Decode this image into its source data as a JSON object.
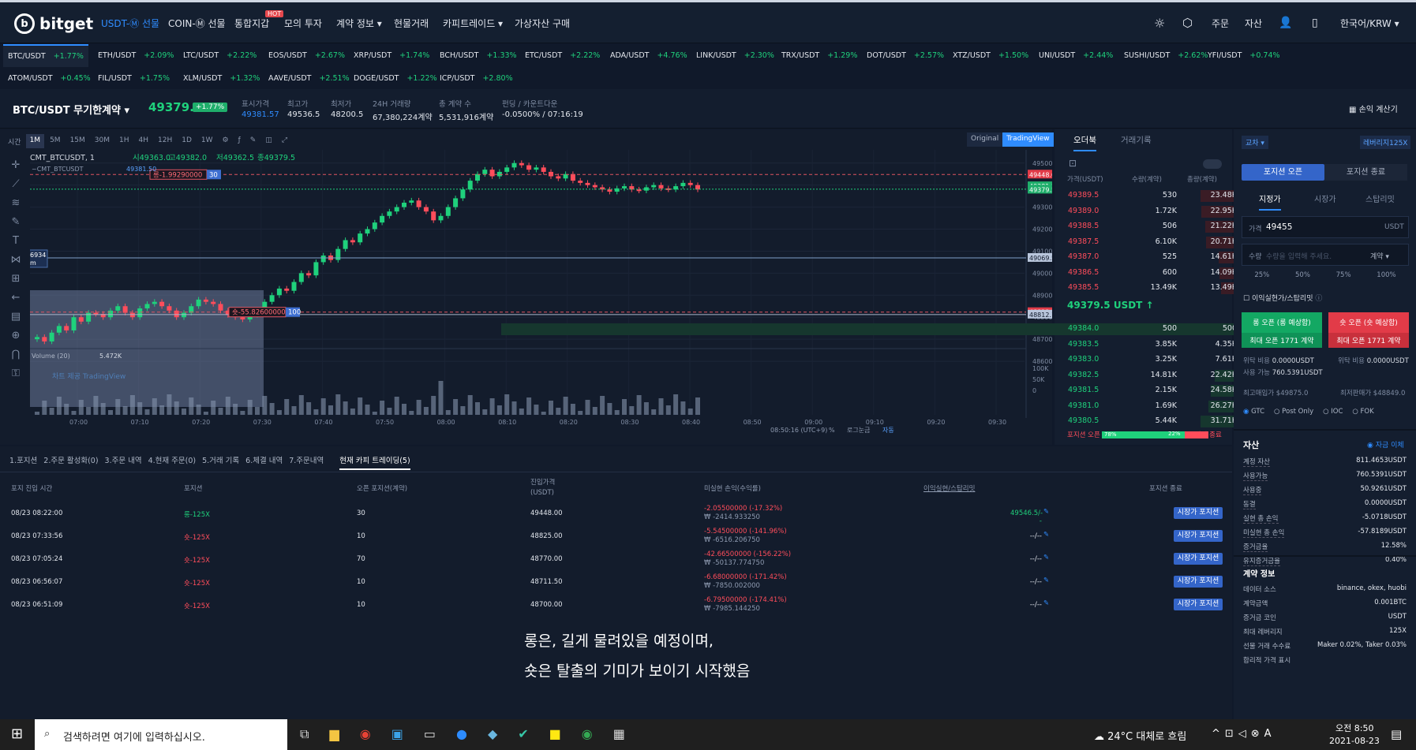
{
  "brand": "bitget",
  "nav": {
    "usdt": "USDT-Ⓜ 선물",
    "coin": "COIN-Ⓜ 선물",
    "unified": "통합지갑",
    "hot": "HOT",
    "mock": "모의 투자",
    "contract": "계약 정보 ▾",
    "spot": "현물거래",
    "copy": "카피트레이드 ▾",
    "buy": "가상자산 구매",
    "order": "주문",
    "assets": "자산",
    "lang": "한국어/KRW ▾"
  },
  "tickers_row1": [
    {
      "s": "BTC/USDT",
      "c": "+1.77%"
    },
    {
      "s": "ETH/USDT",
      "c": "+2.09%"
    },
    {
      "s": "LTC/USDT",
      "c": "+2.22%"
    },
    {
      "s": "EOS/USDT",
      "c": "+2.67%"
    },
    {
      "s": "XRP/USDT",
      "c": "+1.74%"
    },
    {
      "s": "BCH/USDT",
      "c": "+1.33%"
    },
    {
      "s": "ETC/USDT",
      "c": "+2.22%"
    },
    {
      "s": "ADA/USDT",
      "c": "+4.76%"
    },
    {
      "s": "LINK/USDT",
      "c": "+2.30%"
    },
    {
      "s": "TRX/USDT",
      "c": "+1.29%"
    },
    {
      "s": "DOT/USDT",
      "c": "+2.57%"
    },
    {
      "s": "XTZ/USDT",
      "c": "+1.50%"
    },
    {
      "s": "UNI/USDT",
      "c": "+2.44%"
    },
    {
      "s": "SUSHI/USDT",
      "c": "+2.62%"
    },
    {
      "s": "YFI/USDT",
      "c": "+0.74%"
    }
  ],
  "tickers_row2": [
    {
      "s": "ATOM/USDT",
      "c": "+0.45%"
    },
    {
      "s": "FIL/USDT",
      "c": "+1.75%"
    },
    {
      "s": "XLM/USDT",
      "c": "+1.32%"
    },
    {
      "s": "AAVE/USDT",
      "c": "+2.51%"
    },
    {
      "s": "DOGE/USDT",
      "c": "+1.22%"
    },
    {
      "s": "ICP/USDT",
      "c": "+2.80%"
    }
  ],
  "summary": {
    "pair": "BTC/USDT 무기한계약 ▾",
    "last": "49379.5",
    "chg": "+1.77%",
    "mark_l": "표시가격",
    "mark_v": "49381.57",
    "hi_l": "최고가",
    "hi_v": "49536.5",
    "lo_l": "최저가",
    "lo_v": "48200.5",
    "vol_l": "24H 거래량",
    "vol_v": "67,380,224계약",
    "oi_l": "총 계약 수",
    "oi_v": "5,531,916계약",
    "fund_l": "펀딩 / 카운트다운",
    "fund_v": "-0.0500% / 07:16:19",
    "calc": "손익 계산기"
  },
  "chart_toolbar": {
    "time": "시간",
    "iv": [
      "1M",
      "5M",
      "15M",
      "30M",
      "1H",
      "4H",
      "12H",
      "1D",
      "1W"
    ],
    "original": "Original",
    "tv": "TradingView"
  },
  "chart": {
    "symbol": "CMT_BTCUSDT, 1",
    "o": "시49363.0",
    "h": "고49382.0",
    "l": "저49362.5",
    "c": "종49379.5",
    "sub": "~CMT_BTCUSDT",
    "sub_v": "49381.50",
    "long_tag": "롱-1.99290000",
    "long_qty": "30",
    "short_tag": "숏-55.82600000",
    "short_qty": "100",
    "left_tag": "6934",
    "left_tag2": "m",
    "vol_label": "Volume (20)",
    "vol_v": "5.472K",
    "watermark": "차트 제공 TradingView",
    "time_footer": "08:50:16 (UTC+9)",
    "pct": "%",
    "log": "로그눈금",
    "auto": "자동"
  },
  "chart_data": {
    "type": "candlestick",
    "y_ticks": [
      "49500.0",
      "49400.0",
      "49300.0",
      "49200.0",
      "49100.0",
      "49000.0",
      "48900.0",
      "48800.0",
      "48700.0",
      "48600.0"
    ],
    "price_labels": [
      "49448.0",
      "49381.5",
      "49379.5",
      "49069.5",
      "48823.3",
      "48812.1"
    ],
    "x_ticks": [
      "07:00",
      "07:10",
      "07:20",
      "07:30",
      "07:40",
      "07:50",
      "08:00",
      "08:10",
      "08:20",
      "08:30",
      "08:40",
      "08:50",
      "09:00",
      "09:10",
      "09:20",
      "09:30"
    ],
    "vol_ticks": [
      "100K",
      "50K",
      "0"
    ]
  },
  "orderbook": {
    "tab1": "오더북",
    "tab2": "거래기록",
    "h_price": "가격(USDT)",
    "h_qty": "수량(계약)",
    "h_total": "총량(계약)",
    "asks": [
      [
        "49389.5",
        "530",
        "23.48K"
      ],
      [
        "49389.0",
        "1.72K",
        "22.95K"
      ],
      [
        "49388.5",
        "506",
        "21.22K"
      ],
      [
        "49387.5",
        "6.10K",
        "20.71K"
      ],
      [
        "49387.0",
        "525",
        "14.61K"
      ],
      [
        "49386.5",
        "600",
        "14.09K"
      ],
      [
        "49385.5",
        "13.49K",
        "13.49K"
      ]
    ],
    "last": "49379.5 USDT ↑",
    "bids": [
      [
        "49384.0",
        "500",
        "500"
      ],
      [
        "49383.5",
        "3.85K",
        "4.35K"
      ],
      [
        "49383.0",
        "3.25K",
        "7.61K"
      ],
      [
        "49382.5",
        "14.81K",
        "22.42K"
      ],
      [
        "49381.5",
        "2.15K",
        "24.58K"
      ],
      [
        "49381.0",
        "1.69K",
        "26.27K"
      ],
      [
        "49380.5",
        "5.44K",
        "31.71K"
      ]
    ],
    "f_open": "포지션 오픈",
    "f_pct1": "78%",
    "f_pct2": "22%",
    "f_close": "포지션 종료"
  },
  "trade": {
    "cross": "교차 ▾",
    "lev": "레버리지125X",
    "open_tab": "포지션 오픈",
    "close_tab": "포지션 종료",
    "limit": "지정가",
    "market": "시장가",
    "stop": "스탑리밋",
    "price_l": "가격",
    "price_v": "49455",
    "price_u": "USDT",
    "qty_l": "수량",
    "qty_ph": "수량을 입력해 주세요.",
    "qty_u": "계약 ▾",
    "p25": "25%",
    "p50": "50%",
    "p75": "75%",
    "p100": "100%",
    "tpsl": "이익실현가/스탑리밋",
    "long": "롱 오픈 (롱 예상함)",
    "long2": "최대 오픈 1771 계약",
    "short": "숏 오픈 (숏 예상함)",
    "short2": "최대 오픈 1771 계약",
    "margin_l": "위탁 비용",
    "margin_v": "0.0000USDT",
    "avail_l": "사용 가능",
    "avail_v": "760.5391USDT",
    "margin2_l": "위탁 비용",
    "margin2_v": "0.0000USDT",
    "maxbuy": "최고매입가 $49875.0",
    "minsell": "최저판매가 $48849.0",
    "gtc": "GTC",
    "post": "Post Only",
    "ioc": "IOC",
    "fok": "FOK"
  },
  "assets": {
    "title": "자산",
    "transfer": "자금 이체",
    "rows": [
      [
        "계정 자산",
        "811.4653USDT"
      ],
      [
        "사용가능",
        "760.5391USDT"
      ],
      [
        "사용중",
        "50.9261USDT"
      ],
      [
        "동결",
        "0.0000USDT"
      ],
      [
        "실현 총 손익",
        "-5.0718USDT"
      ],
      [
        "미실현 총 손익",
        "-57.8189USDT"
      ],
      [
        "증거금율",
        "12.58%"
      ],
      [
        "유지증거금율",
        "0.40%"
      ]
    ]
  },
  "contract": {
    "title": "계약 정보",
    "rows": [
      [
        "데이터 소스",
        "binance, okex, huobi"
      ],
      [
        "계약금액",
        "0.001BTC"
      ],
      [
        "증거금 코인",
        "USDT"
      ],
      [
        "최대 레버리지",
        "125X"
      ],
      [
        "선물 거래 수수료",
        "Maker 0.02%, Taker 0.03%"
      ],
      [
        "합리적 가격 표시",
        ""
      ]
    ]
  },
  "pos_tabs": [
    "1.포지션",
    "2.주문 활성화(0)",
    "3.주문 내역",
    "4.현재 주문(0)",
    "5.거래 기록",
    "6.체결 내역",
    "7.주문내역",
    "현재 카피 트레이딩(5)"
  ],
  "pos_headers": [
    "포지 진입 시간",
    "포지션",
    "오픈 포지션(계약)",
    "진입가격\n(USDT)",
    "미실현 손익(수익률)",
    "이익실현/스탑리밋",
    "포지션 종료"
  ],
  "positions": [
    {
      "time": "08/23 08:22:00",
      "side": "롱-125X",
      "qty": "30",
      "price": "49448.00",
      "pnl": "-2.05500000 (-17.32%)",
      "pnl2": "₩ -2414.933250",
      "tp": "49546.5/--",
      "btn": "시장가 포지션"
    },
    {
      "time": "08/23 07:33:56",
      "side": "숏-125X",
      "qty": "10",
      "price": "48825.00",
      "pnl": "-5.54500000 (-141.96%)",
      "pnl2": "₩ -6516.206750",
      "tp": "--/--",
      "btn": "시장가 포지션"
    },
    {
      "time": "08/23 07:05:24",
      "side": "숏-125X",
      "qty": "70",
      "price": "48770.00",
      "pnl": "-42.66500000 (-156.22%)",
      "pnl2": "₩ -50137.774750",
      "tp": "--/--",
      "btn": "시장가 포지션"
    },
    {
      "time": "08/23 06:56:07",
      "side": "숏-125X",
      "qty": "10",
      "price": "48711.50",
      "pnl": "-6.68000000 (-171.42%)",
      "pnl2": "₩ -7850.002000",
      "tp": "--/--",
      "btn": "시장가 포지션"
    },
    {
      "time": "08/23 06:51:09",
      "side": "숏-125X",
      "qty": "10",
      "price": "48700.00",
      "pnl": "-6.79500000 (-174.41%)",
      "pnl2": "₩ -7985.144250",
      "tp": "--/--",
      "btn": "시장가 포지션"
    }
  ],
  "caption": {
    "line1": "롱은, 길게 물려있을 예정이며,",
    "line2": "숏은 탈출의 기미가 보이기 시작했음"
  },
  "taskbar": {
    "search": "검색하려면 여기에 입력하십시오.",
    "weather": "24°C  대체로 흐림",
    "time": "오전 8:50",
    "date": "2021-08-23"
  }
}
